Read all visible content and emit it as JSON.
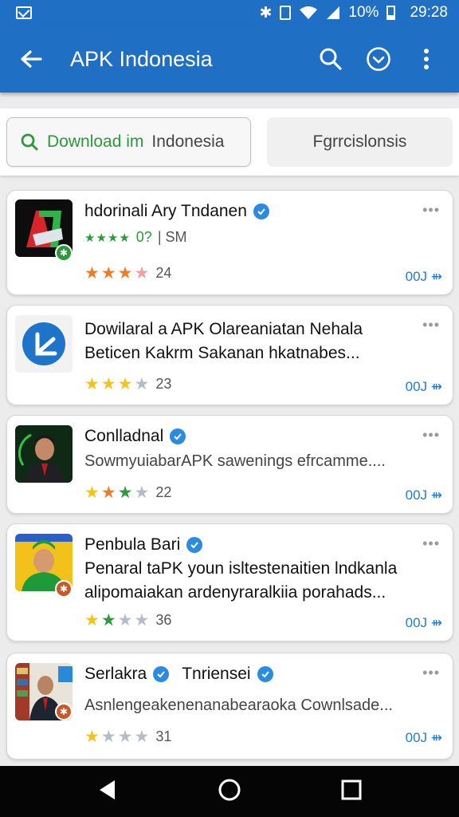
{
  "status_bar": {
    "battery": "10%",
    "time": "29:28",
    "icons": [
      "mail-icon",
      "bluetooth-icon",
      "vibrate-icon",
      "wifi-icon",
      "signal-icon",
      "battery-icon"
    ]
  },
  "app_bar": {
    "title": "APK Indonesia"
  },
  "tabs": [
    {
      "label": "Download im",
      "label_extra": "Indonesia",
      "icon": "search-icon",
      "selected": true
    },
    {
      "label": "Fgrrcislonsis"
    }
  ],
  "cards": [
    {
      "title": "hdorinali Ary Tndanen",
      "verified": true,
      "sub": "0?",
      "sub_extra": "| SM",
      "rating": 24,
      "stars": 4,
      "action": "00J ⇻"
    },
    {
      "title": "Dowilaral a APK Olareaniatan Nehala",
      "desc": "Beticen Kakrm Sakanan hkatnabes...",
      "rating": 23,
      "stars": 3,
      "action": "00J ⇻"
    },
    {
      "title": "Conlladnal",
      "verified": true,
      "desc": "SowmyuiabarAPK sawenings efrcamme....",
      "rating": 22,
      "stars": 3,
      "action": "00J ⇻"
    },
    {
      "title": "Penbula Bari",
      "verified": true,
      "desc": "Penaral taPK youn isltestenaitien lndkanla",
      "desc2": "alipomaiakan ardenyraralkiia porahads...",
      "rating": 36,
      "stars": 2,
      "action": "00J ⇻"
    },
    {
      "title": "Serlakra",
      "title2": "Tnriensei",
      "verified": true,
      "desc": "Asnlengeakenenanabearaoka Cownlsade...",
      "rating": 31,
      "stars": 1,
      "action": "00J ⇻"
    }
  ],
  "more_label": "•••",
  "colors": {
    "primary": "#1f6fc4",
    "accent_green": "#2a9a3a",
    "link_blue": "#1d7bd6",
    "star_orange": "#f07b27",
    "star_yellow": "#f4c21a"
  },
  "nav": {
    "icons": [
      "back-triangle-icon",
      "home-circle-icon",
      "recents-square-icon"
    ]
  }
}
